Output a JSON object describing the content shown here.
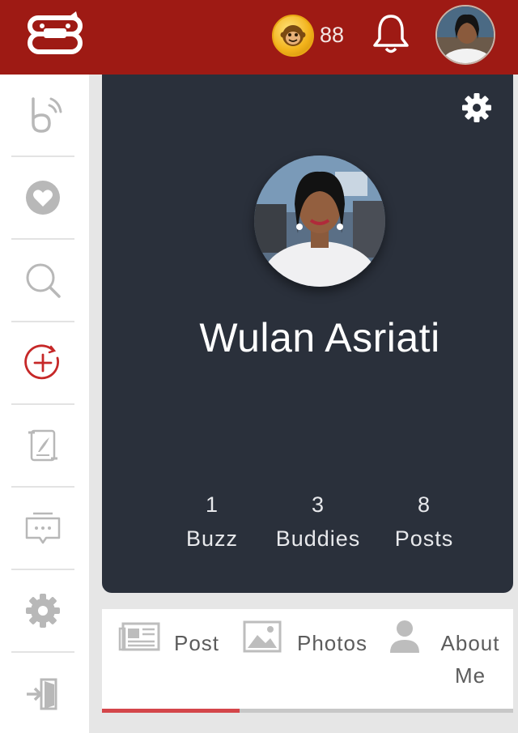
{
  "header": {
    "coin_count": "88",
    "icons": [
      "app-logo-icon",
      "coin-monkey-icon",
      "bell-icon"
    ],
    "colors": {
      "header_bg": "#9e1a14",
      "coin": "#f2b21a"
    }
  },
  "sidebar": {
    "items": [
      {
        "icon": "buzz-logo-icon"
      },
      {
        "icon": "heart-icon"
      },
      {
        "icon": "search-icon"
      },
      {
        "icon": "add-circle-icon",
        "accent": "#c62828"
      },
      {
        "icon": "scroll-quill-icon"
      },
      {
        "icon": "chat-bubble-icon"
      },
      {
        "icon": "settings-icon"
      },
      {
        "icon": "logout-icon"
      }
    ]
  },
  "profile": {
    "name": "Wulan Asriati",
    "stats": [
      {
        "value": "1",
        "label": "Buzz"
      },
      {
        "value": "3",
        "label": "Buddies"
      },
      {
        "value": "8",
        "label": "Posts"
      }
    ],
    "card_color": "#2a303b"
  },
  "tabs": {
    "items": [
      {
        "label": "Post",
        "icon": "newspaper-icon",
        "active": true
      },
      {
        "label": "Photos",
        "icon": "image-icon",
        "active": false
      },
      {
        "label_line1": "About",
        "label_line2": "Me",
        "icon": "person-icon",
        "active": false
      }
    ],
    "active_color": "#d4464a"
  }
}
